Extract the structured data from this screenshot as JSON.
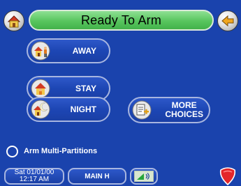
{
  "header": {
    "status_text": "Ready To Arm",
    "home_icon": "home-icon",
    "back_icon": "back-arrow-icon"
  },
  "buttons": {
    "away": {
      "label": "AWAY",
      "icon": "house-person-icon"
    },
    "stay": {
      "label": "STAY",
      "icon": "house-inside-icon"
    },
    "night": {
      "label": "NIGHT",
      "icon": "house-moon-icon"
    },
    "more": {
      "label_line1": "MORE",
      "label_line2": "CHOICES",
      "icon": "notepad-plus-icon"
    }
  },
  "multi_partitions": {
    "label": "Arm Multi-Partitions",
    "selected": false
  },
  "footer": {
    "date": "Sat 01/01/00",
    "time": "12:17 AM",
    "main_label": "MAIN H",
    "signal_icon": "signal-strength-icon",
    "shield_icon": "shield-icon"
  },
  "colors": {
    "background": "#1a43ad",
    "status_green": "#58c55e",
    "button_border": "#a8b6e0",
    "shield_red": "#e3262a"
  }
}
